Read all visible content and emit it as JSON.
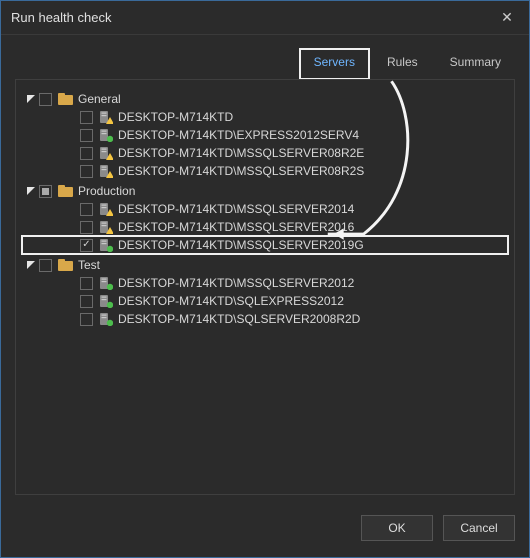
{
  "window": {
    "title": "Run health check"
  },
  "tabs": {
    "servers": "Servers",
    "rules": "Rules",
    "summary": "Summary",
    "active": "servers"
  },
  "tree": [
    {
      "name": "General",
      "check": "empty",
      "items": [
        {
          "label": "DESKTOP-M714KTD",
          "status": "warn",
          "check": "empty"
        },
        {
          "label": "DESKTOP-M714KTD\\EXPRESS2012SERV4",
          "status": "ok",
          "check": "empty"
        },
        {
          "label": "DESKTOP-M714KTD\\MSSQLSERVER08R2E",
          "status": "warn",
          "check": "empty"
        },
        {
          "label": "DESKTOP-M714KTD\\MSSQLSERVER08R2S",
          "status": "warn",
          "check": "empty"
        }
      ]
    },
    {
      "name": "Production",
      "check": "indeterminate",
      "items": [
        {
          "label": "DESKTOP-M714KTD\\MSSQLSERVER2014",
          "status": "warn",
          "check": "empty"
        },
        {
          "label": "DESKTOP-M714KTD\\MSSQLSERVER2016",
          "status": "warn",
          "check": "empty"
        },
        {
          "label": "DESKTOP-M714KTD\\MSSQLSERVER2019G",
          "status": "ok",
          "check": "checked",
          "highlight": true
        }
      ]
    },
    {
      "name": "Test",
      "check": "empty",
      "items": [
        {
          "label": "DESKTOP-M714KTD\\MSSQLSERVER2012",
          "status": "ok",
          "check": "empty"
        },
        {
          "label": "DESKTOP-M714KTD\\SQLEXPRESS2012",
          "status": "ok",
          "check": "empty"
        },
        {
          "label": "DESKTOP-M714KTD\\SQLSERVER2008R2D",
          "status": "ok",
          "check": "empty"
        }
      ]
    }
  ],
  "buttons": {
    "ok": "OK",
    "cancel": "Cancel"
  },
  "colors": {
    "accent": "#6fb6ff",
    "warn": "#f4c542",
    "ok": "#4dbd4d"
  }
}
